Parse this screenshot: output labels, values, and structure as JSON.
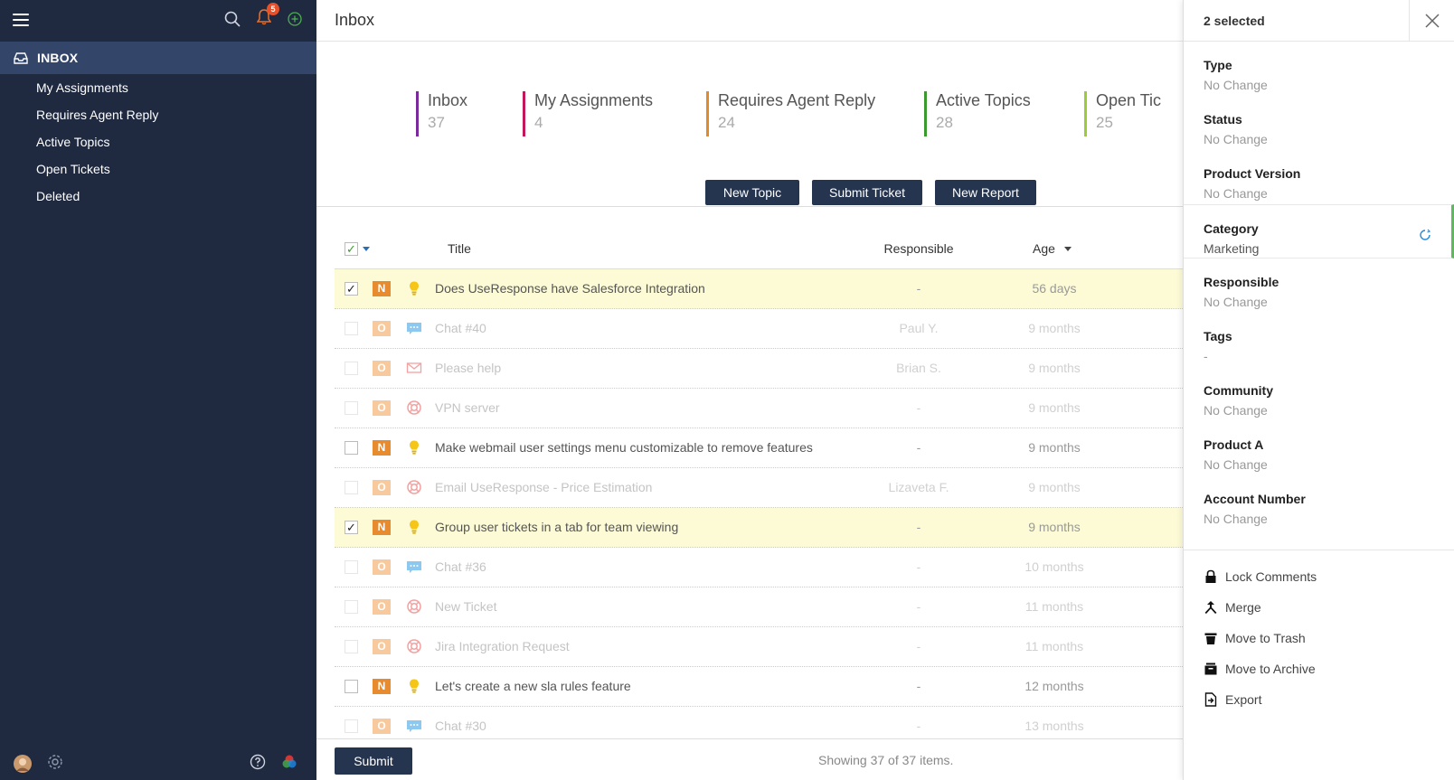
{
  "sidebar": {
    "notification_count": "5",
    "inbox_label": "INBOX",
    "items": [
      {
        "label": "My Assignments"
      },
      {
        "label": "Requires Agent Reply"
      },
      {
        "label": "Active Topics"
      },
      {
        "label": "Open Tickets"
      },
      {
        "label": "Deleted"
      }
    ]
  },
  "main": {
    "title": "Inbox",
    "stats": [
      {
        "title": "Inbox",
        "value": "37",
        "color": "#7b2a9c"
      },
      {
        "title": "My Assignments",
        "value": "4",
        "color": "#c2185b"
      },
      {
        "title": "Requires Agent Reply",
        "value": "24",
        "color": "#e08a2a"
      },
      {
        "title": "Active Topics",
        "value": "28",
        "color": "#3a9a2e"
      },
      {
        "title": "Open Tic",
        "value": "25",
        "color": "#9ccc3a"
      }
    ],
    "buttons": {
      "new_topic": "New Topic",
      "submit_ticket": "Submit Ticket",
      "new_report": "New Report"
    },
    "columns": {
      "title": "Title",
      "responsible": "Responsible",
      "age": "Age"
    },
    "rows": [
      {
        "checked": true,
        "badge": "N",
        "icon": "bulb",
        "title": "Does UseResponse have Salesforce Integration",
        "responsible": "-",
        "age": "56 days"
      },
      {
        "checked": false,
        "badge": "O",
        "icon": "chat",
        "title": "Chat #40",
        "responsible": "Paul Y.",
        "age": "9 months"
      },
      {
        "checked": false,
        "badge": "O",
        "icon": "mail",
        "title": "Please help",
        "responsible": "Brian S.",
        "age": "9 months"
      },
      {
        "checked": false,
        "badge": "O",
        "icon": "help",
        "title": "VPN server",
        "responsible": "-",
        "age": "9 months"
      },
      {
        "checked": false,
        "badge": "N",
        "icon": "bulb",
        "title": "Make webmail user settings menu customizable to remove features",
        "responsible": "-",
        "age": "9 months"
      },
      {
        "checked": false,
        "badge": "O",
        "icon": "help",
        "title": "Email UseResponse - Price Estimation",
        "responsible": "Lizaveta F.",
        "age": "9 months"
      },
      {
        "checked": true,
        "badge": "N",
        "icon": "bulb",
        "title": "Group user tickets in a tab for team viewing",
        "responsible": "-",
        "age": "9 months"
      },
      {
        "checked": false,
        "badge": "O",
        "icon": "chat",
        "title": "Chat #36",
        "responsible": "-",
        "age": "10 months"
      },
      {
        "checked": false,
        "badge": "O",
        "icon": "help",
        "title": "New Ticket",
        "responsible": "-",
        "age": "11 months"
      },
      {
        "checked": false,
        "badge": "O",
        "icon": "help",
        "title": "Jira Integration Request",
        "responsible": "-",
        "age": "11 months"
      },
      {
        "checked": false,
        "badge": "N",
        "icon": "bulb",
        "title": "Let's create a new sla rules feature",
        "responsible": "-",
        "age": "12 months"
      },
      {
        "checked": false,
        "badge": "O",
        "icon": "chat",
        "title": "Chat #30",
        "responsible": "-",
        "age": "13 months"
      }
    ],
    "footer": {
      "submit": "Submit",
      "showing": "Showing 37 of 37 items."
    }
  },
  "panel": {
    "selected": "2 selected",
    "fields": [
      {
        "label": "Type",
        "value": "No Change"
      },
      {
        "label": "Status",
        "value": "No Change"
      },
      {
        "label": "Product Version",
        "value": "No Change"
      },
      {
        "label": "Category",
        "value": "Marketing"
      },
      {
        "label": "Responsible",
        "value": "No Change"
      },
      {
        "label": "Tags",
        "value": "-"
      },
      {
        "label": "Community",
        "value": "No Change"
      },
      {
        "label": "Product A",
        "value": "No Change"
      },
      {
        "label": "Account Number",
        "value": "No Change"
      }
    ],
    "actions": [
      {
        "label": "Lock Comments",
        "icon": "lock-icon"
      },
      {
        "label": "Merge",
        "icon": "merge-icon"
      },
      {
        "label": "Move to Trash",
        "icon": "trash-icon"
      },
      {
        "label": "Move to Archive",
        "icon": "archive-icon"
      },
      {
        "label": "Export",
        "icon": "export-icon"
      }
    ]
  }
}
